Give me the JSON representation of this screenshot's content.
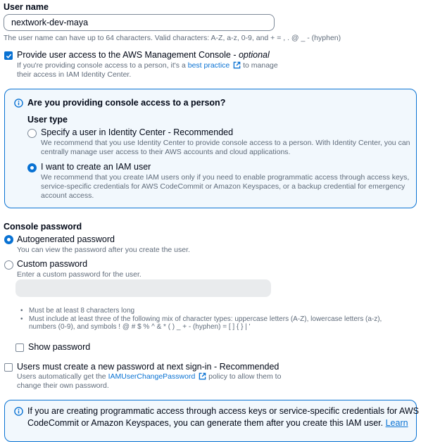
{
  "user_name": {
    "label": "User name",
    "value": "nextwork-dev-maya",
    "hint": "The user name can have up to 64 characters. Valid characters: A-Z, a-z, 0-9, and + = , . @ _ - (hyphen)"
  },
  "console_access": {
    "label_main": "Provide user access to the AWS Management Console - ",
    "label_optional": "optional",
    "checked": true,
    "desc_before": "If you're providing console access to a person, it's a ",
    "desc_link": "best practice",
    "desc_after": " to manage",
    "desc_line2": "their access in IAM Identity Center."
  },
  "person_box": {
    "title": "Are you providing console access to a person?",
    "user_type_label": "User type",
    "options": [
      {
        "title": "Specify a user in Identity Center - Recommended",
        "desc1": "We recommend that you use Identity Center to provide console access to a person. With Identity Center, you can",
        "desc2": "centrally manage user access to their AWS accounts and cloud applications.",
        "selected": false
      },
      {
        "title": "I want to create an IAM user",
        "desc1": "We recommend that you create IAM users only if you need to enable programmatic access through access keys,",
        "desc2": "service-specific credentials for AWS CodeCommit or Amazon Keyspaces, or a backup credential for emergency",
        "desc3": "account access.",
        "selected": true
      }
    ]
  },
  "password": {
    "label": "Console password",
    "options": [
      {
        "title": "Autogenerated password",
        "desc": "You can view the password after you create the user.",
        "selected": true
      },
      {
        "title": "Custom password",
        "desc": "Enter a custom password for the user.",
        "selected": false
      }
    ],
    "custom_value": "",
    "rules": [
      "Must be at least 8 characters long",
      "Must include at least three of the following mix of character types: uppercase letters (A-Z), lowercase letters (a-z),",
      "numbers (0-9), and symbols ! @ # $ % ^ & * ( ) _ + - (hyphen) = [ ] { } | '"
    ],
    "show_password_label": "Show password",
    "show_password_checked": false
  },
  "reset": {
    "label": "Users must create a new password at next sign-in - Recommended",
    "checked": false,
    "desc_before": "Users automatically get the ",
    "desc_link": "IAMUserChangePassword",
    "desc_after": " policy to allow them to",
    "desc_line2": "change their own password."
  },
  "bottom_info": {
    "line1": "If you are creating programmatic access through access keys or service-specific credentials for AWS",
    "line2_before": "CodeCommit or Amazon Keyspaces, you can generate them after you create this IAM user. ",
    "line2_link": "Learn"
  },
  "colors": {
    "accent": "#0972d3",
    "info_bg": "#f2f8fd",
    "hint": "#5f6b7a",
    "text": "#000716"
  },
  "icons": [
    "info-circle-icon",
    "external-link-icon",
    "checkmark-icon"
  ]
}
